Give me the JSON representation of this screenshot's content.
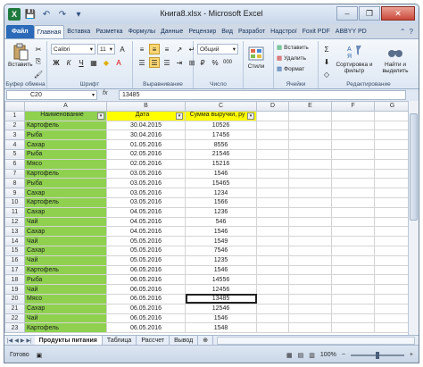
{
  "window": {
    "title": "Книга8.xlsx - Microsoft Excel",
    "app_icon": "excel-icon",
    "min": "–",
    "max": "❐",
    "close": "✕"
  },
  "qat": {
    "save_icon": "save-icon",
    "undo_icon": "undo-icon",
    "redo_icon": "redo-icon"
  },
  "ribbon_tabs": [
    "Файл",
    "Главная",
    "Вставка",
    "Разметка",
    "Формулы",
    "Данные",
    "Рецензир",
    "Вид",
    "Разработ",
    "Надстрої",
    "Foxit PDF",
    "ABBYY PD"
  ],
  "active_tab": "Главная",
  "ribbon": {
    "paste_label": "Вставить",
    "font_name": "Calibri",
    "font_size": "11",
    "number_format": "Общий",
    "styles_label": "Стили",
    "insert_label": "Вставить",
    "delete_label": "Удалить",
    "format_label": "Формат",
    "sort_label": "Сортировка и фильтр",
    "find_label": "Найти и выделить",
    "groups": {
      "clipboard": "Буфер обмена",
      "font": "Шрифт",
      "alignment": "Выравнивание",
      "number": "Число",
      "cells": "Ячейки",
      "editing": "Редактирование"
    },
    "pct": "%",
    "thousands": "000",
    "bold": "Ж",
    "italic": "К",
    "underline": "Ч",
    "sigma": "Σ"
  },
  "formula_bar": {
    "cell_ref": "C20",
    "fx": "fx",
    "value": "13485"
  },
  "columns": [
    "A",
    "B",
    "C",
    "D",
    "E",
    "F",
    "G"
  ],
  "header_row": {
    "a": "Наименование",
    "b": "Дата",
    "c": "Сумма выручки, ру"
  },
  "rows": [
    {
      "n": "1",
      "a": "",
      "b": "",
      "c": ""
    },
    {
      "n": "2",
      "a": "Картофель",
      "b": "30.04.2015",
      "c": "10526"
    },
    {
      "n": "3",
      "a": "Рыба",
      "b": "30.04.2016",
      "c": "17456"
    },
    {
      "n": "4",
      "a": "Сахар",
      "b": "01.05.2016",
      "c": "8556"
    },
    {
      "n": "5",
      "a": "Рыба",
      "b": "02.05.2016",
      "c": "21546"
    },
    {
      "n": "6",
      "a": "Мясо",
      "b": "02.05.2016",
      "c": "15216"
    },
    {
      "n": "7",
      "a": "Картофель",
      "b": "03.05.2016",
      "c": "1546"
    },
    {
      "n": "8",
      "a": "Рыба",
      "b": "03.05.2016",
      "c": "15465"
    },
    {
      "n": "9",
      "a": "Сахар",
      "b": "03.05.2016",
      "c": "1234"
    },
    {
      "n": "10",
      "a": "Картофель",
      "b": "03.05.2016",
      "c": "1566"
    },
    {
      "n": "11",
      "a": "Сахар",
      "b": "04.05.2016",
      "c": "1236"
    },
    {
      "n": "12",
      "a": "Чай",
      "b": "04.05.2016",
      "c": "546"
    },
    {
      "n": "13",
      "a": "Сахар",
      "b": "04.05.2016",
      "c": "1546"
    },
    {
      "n": "14",
      "a": "Чай",
      "b": "05.05.2016",
      "c": "1549"
    },
    {
      "n": "15",
      "a": "Сахар",
      "b": "05.05.2016",
      "c": "7546"
    },
    {
      "n": "16",
      "a": "Чай",
      "b": "05.05.2016",
      "c": "1235"
    },
    {
      "n": "17",
      "a": "Картофель",
      "b": "06.05.2016",
      "c": "1546"
    },
    {
      "n": "18",
      "a": "Рыба",
      "b": "06.05.2016",
      "c": "14556"
    },
    {
      "n": "19",
      "a": "Чай",
      "b": "06.05.2016",
      "c": "12456"
    },
    {
      "n": "20",
      "a": "Мясо",
      "b": "06.05.2016",
      "c": "13485"
    },
    {
      "n": "21",
      "a": "Сахар",
      "b": "06.05.2016",
      "c": "12546"
    },
    {
      "n": "22",
      "a": "Чай",
      "b": "06.05.2016",
      "c": "1546"
    },
    {
      "n": "23",
      "a": "Картофель",
      "b": "06.05.2016",
      "c": "1548"
    }
  ],
  "sheet_tabs": [
    "Продукты питания",
    "Таблица",
    "Рассчет",
    "Вывод"
  ],
  "active_sheet": "Продукты питания",
  "status": {
    "ready": "Готово",
    "zoom": "100%"
  },
  "colors": {
    "green_fill": "#8fd14f",
    "yellow_fill": "#ffff00",
    "selected_header": "#f1c15f",
    "file_tab": "#2a6ab8"
  }
}
